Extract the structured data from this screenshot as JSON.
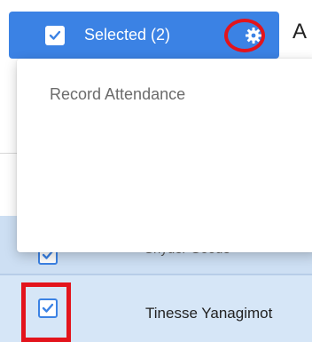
{
  "toolbar": {
    "selected_label": "Selected (2)",
    "title_truncated": "A"
  },
  "dropdown": {
    "items": [
      {
        "label": "Record Attendance"
      }
    ]
  },
  "table": {
    "rows": [
      {
        "name": "Snyder Goode",
        "selected": true
      },
      {
        "name": "Tinesse Yanagimot",
        "selected": true
      }
    ]
  },
  "colors": {
    "accent": "#3b82e4",
    "highlight": "#e3141c",
    "row_selected": "#d6e6f7"
  }
}
